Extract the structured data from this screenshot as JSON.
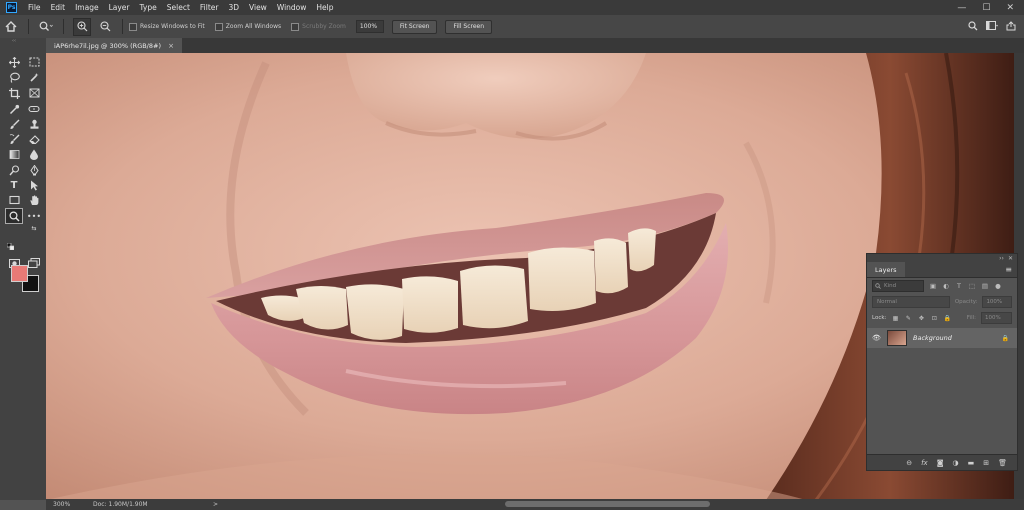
{
  "menubar": {
    "logo": "Ps",
    "items": [
      "File",
      "Edit",
      "Image",
      "Layer",
      "Type",
      "Select",
      "Filter",
      "3D",
      "View",
      "Window",
      "Help"
    ],
    "controls": {
      "minimize": "—",
      "maximize": "☐",
      "close": "✕"
    }
  },
  "options": {
    "resize_windows": "Resize Windows to Fit",
    "zoom_all_windows": "Zoom All Windows",
    "scrubby_zoom": "Scrubby Zoom",
    "zoom_value": "100%",
    "fit_screen": "Fit Screen",
    "fill_screen": "Fill Screen"
  },
  "document": {
    "tab_title": "iAP6rhe7il.jpg @ 300% (RGB/8#)",
    "close": "×"
  },
  "status": {
    "zoom": "300%",
    "doc_size": "Doc: 1.90M/1.90M",
    "arrow": ">"
  },
  "layers": {
    "tab": "Layers",
    "kind": "Kind",
    "blend_mode": "Normal",
    "opacity_label": "Opacity:",
    "opacity_value": "100%",
    "lock_label": "Lock:",
    "fill_label": "Fill:",
    "fill_value": "100%",
    "layer_name": "Background"
  },
  "colors": {
    "foreground": "#e87a76",
    "background": "#111111",
    "accent": "#31a8ff"
  }
}
